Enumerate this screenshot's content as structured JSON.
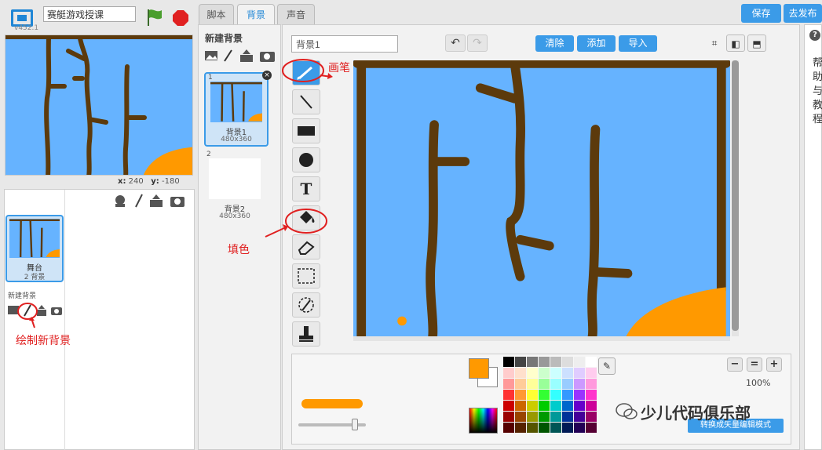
{
  "header": {
    "version": "v452.1",
    "project_title": "赛艇游戏授课"
  },
  "stage": {
    "x_label": "x:",
    "x_value": "240",
    "y_label": "y:",
    "y_value": "-180"
  },
  "sprites": {
    "stage_label": "舞台",
    "stage_count": "2 背景",
    "new_backdrop_small": "新建背景"
  },
  "tabs": [
    {
      "label": "脚本"
    },
    {
      "label": "背景"
    },
    {
      "label": "声音"
    }
  ],
  "actions": {
    "save": "保存",
    "publish": "去发布"
  },
  "backdrop_list": {
    "title": "新建背景",
    "items": [
      {
        "number": "1",
        "name": "背景1",
        "size": "480x360"
      },
      {
        "number": "2",
        "name": "背景2",
        "size": "480x360"
      }
    ]
  },
  "editor": {
    "name_value": "背景1",
    "clear": "清除",
    "add": "添加",
    "import": "导入",
    "zoom_level": "100%",
    "convert": "转换成矢量编辑模式",
    "text_tool_glyph": "T"
  },
  "annotations": {
    "brush": "画笔",
    "fill": "填色",
    "draw_new": "绘制新背景"
  },
  "help": {
    "text": "帮助与教程"
  },
  "watermark": "少儿代码俱乐部",
  "colors": {
    "sky": "#66b3ff",
    "trunk": "#5c3a0c",
    "orange": "#ff9900",
    "accent": "#3b9be8",
    "annotation": "#e02020"
  }
}
